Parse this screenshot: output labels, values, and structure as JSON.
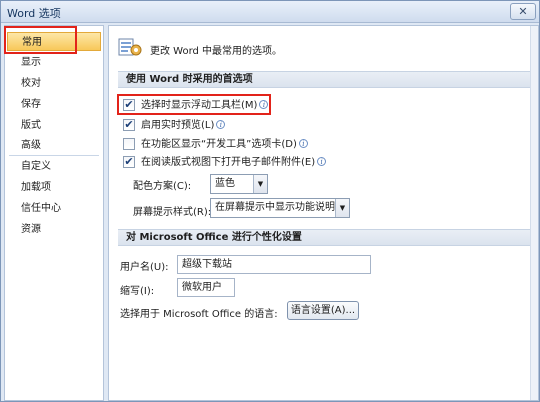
{
  "window": {
    "title": "Word 选项",
    "close_glyph": "✕"
  },
  "sidebar": {
    "items": [
      {
        "label": "常用",
        "selected": true
      },
      {
        "label": "显示"
      },
      {
        "label": "校对"
      },
      {
        "label": "保存"
      },
      {
        "label": "版式"
      },
      {
        "label": "高级"
      },
      {
        "label": "自定义"
      },
      {
        "label": "加载项"
      },
      {
        "label": "信任中心"
      },
      {
        "label": "资源"
      }
    ]
  },
  "content": {
    "header": "更改 Word 中最常用的选项。",
    "section1": {
      "title": "使用 Word 时采用的首选项",
      "options": [
        {
          "label": "选择时显示浮动工具栏(M)",
          "checked": true
        },
        {
          "label": "启用实时预览(L)",
          "checked": true
        },
        {
          "label": "在功能区显示“开发工具”选项卡(D)",
          "checked": false
        },
        {
          "label": "在阅读版式视图下打开电子邮件附件(E)",
          "checked": true
        }
      ],
      "color_scheme": {
        "label": "配色方案(C):",
        "value": "蓝色"
      },
      "tooltip_style": {
        "label": "屏幕提示样式(R):",
        "value": "在屏幕提示中显示功能说明"
      }
    },
    "section2": {
      "title": "对 Microsoft Office 进行个性化设置",
      "username": {
        "label": "用户名(U):",
        "value": "超级下载站"
      },
      "initials": {
        "label": "缩写(I):",
        "value": "微软用户"
      },
      "language": {
        "label": "选择用于 Microsoft Office 的语言:",
        "button": "语言设置(A)..."
      }
    }
  },
  "check_glyph": "✔",
  "info_glyph": "i",
  "arrow_glyph": "▼",
  "colors": {
    "highlight": "#e2231a",
    "selected_bg": "#f8c85a",
    "section_bg": "#dbe3ee"
  }
}
